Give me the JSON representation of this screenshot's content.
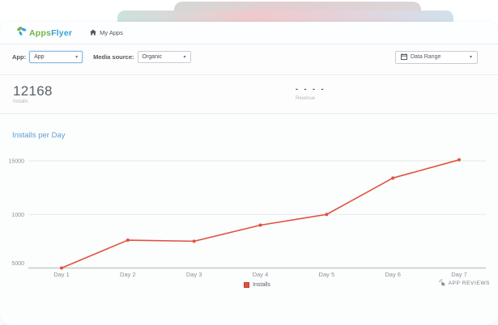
{
  "brand": {
    "logo_text_green": "Apps",
    "logo_text_blue": "Flyer"
  },
  "nav": {
    "my_apps_label": "My Apps"
  },
  "icons": {
    "chevron_down": "▾"
  },
  "filters": {
    "app_label": "App:",
    "app_selected": "App",
    "media_source_label": "Media source:",
    "media_source_selected": "Organic",
    "data_range_label": "Data Range"
  },
  "stats": {
    "installs_value": "12168",
    "installs_label": "Installs",
    "revenue_value": "- - - -",
    "revenue_label": "Revenue"
  },
  "chart_section": {
    "title": "Installs per Day",
    "legend_label": "Installs",
    "app_reviews_label": "APP REVIEWS"
  },
  "chart_data": {
    "type": "line",
    "title": "Installs per Day",
    "categories": [
      "Day 1",
      "Day 2",
      "Day 3",
      "Day 4",
      "Day 5",
      "Day 6",
      "Day 7"
    ],
    "series": [
      {
        "name": "Installs",
        "color": "#e0523f",
        "values": [
          5000,
          7600,
          7500,
          9000,
          10000,
          13400,
          15100
        ]
      }
    ],
    "ylim": [
      5000,
      15000
    ],
    "yticks": [
      {
        "value": 15000,
        "label": "15000"
      },
      {
        "value": 10000,
        "label": "1000"
      },
      {
        "value": 5000,
        "label": "5000"
      }
    ],
    "grid": true,
    "legend_position": "bottom-center",
    "xlabel": "",
    "ylabel": ""
  },
  "colors": {
    "accent_line": "#e0523f",
    "logo_green": "#6fb543",
    "logo_blue": "#389fd9",
    "chart_title_blue": "#5f9ed2",
    "select_focus_border": "#85b8dd",
    "grid_line": "#e8e8e9",
    "axis_line": "#c6c8ca"
  }
}
